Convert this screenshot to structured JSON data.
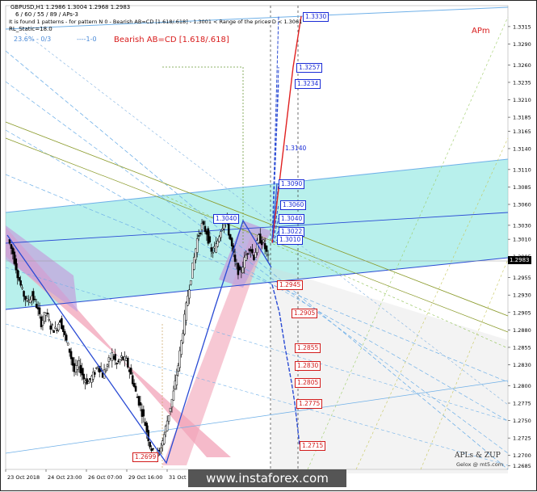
{
  "header": {
    "symbol_line": "GBPUSD,H1  1.2986 1.3004 1.2968 1.2983",
    "params_line": "6 / 60 / 55 / 89 / APs-3",
    "pattern_line": "It is found 1 patterns  -  for pattern N 0 - Bearish AB=CD [1.618/.618] - 1.3001 < Range of the prices D < 1.3061",
    "static_line": "RL_Static=18.0",
    "fib_label": "23.6% - 0/3",
    "level_label": "----1-0",
    "pattern_title": "Bearish AB=CD [1.618/.618]",
    "corner_label": "APm"
  },
  "watermark": {
    "brand": "APLs & ZUP",
    "copyright": "Gelox @ mt5.com",
    "site": "www.instaforex.com"
  },
  "current_price": "1.2983",
  "chart_data": {
    "type": "candlestick",
    "title": "GBPUSD,H1",
    "x_ticks": [
      "23 Oct 2018",
      "24 Oct 23:00",
      "26 Oct 07:00",
      "29 Oct 16:00",
      "31 Oct 00:00"
    ],
    "y_ticks": [
      "1.3315",
      "1.3290",
      "1.3260",
      "1.3235",
      "1.3210",
      "1.3185",
      "1.3165",
      "1.3140",
      "1.3110",
      "1.3085",
      "1.3060",
      "1.3030",
      "1.3010",
      "1.2985",
      "1.2955",
      "1.2930",
      "1.2905",
      "1.2880",
      "1.2855",
      "1.2830",
      "1.2800",
      "1.2775",
      "1.2750",
      "1.2725",
      "1.2700",
      "1.2685"
    ],
    "ylim": [
      1.268,
      1.3345
    ],
    "price_path": [
      1.301,
      1.299,
      1.296,
      1.2935,
      1.292,
      1.293,
      1.2915,
      1.289,
      1.2905,
      1.2885,
      1.288,
      1.2895,
      1.287,
      1.285,
      1.282,
      1.283,
      1.281,
      1.2805,
      1.2815,
      1.283,
      1.2815,
      1.283,
      1.2845,
      1.283,
      1.284,
      1.2835,
      1.2815,
      1.279,
      1.277,
      1.2745,
      1.2715,
      1.2699,
      1.2705,
      1.273,
      1.276,
      1.279,
      1.283,
      1.288,
      1.293,
      1.297,
      1.301,
      1.303,
      1.302,
      1.299,
      1.3,
      1.3025,
      1.304,
      1.301,
      1.2975,
      1.296,
      1.298,
      1.3,
      1.2985,
      1.3012,
      1.3004,
      1.2983
    ],
    "levels_blue": [
      {
        "label": "1.3330",
        "value": 1.333
      },
      {
        "label": "1.3257",
        "value": 1.3257
      },
      {
        "label": "1.3234",
        "value": 1.3234
      },
      {
        "label": "1.3090",
        "value": 1.309
      },
      {
        "label": "1.3060",
        "value": 1.306
      },
      {
        "label": "1.3040",
        "value": 1.304
      },
      {
        "label": "1.3022",
        "value": 1.3022
      },
      {
        "label": "1.3010",
        "value": 1.301
      }
    ],
    "levels_red": [
      {
        "label": "1.2945",
        "value": 1.2945
      },
      {
        "label": "1.2905",
        "value": 1.2905
      },
      {
        "label": "1.2855",
        "value": 1.2855
      },
      {
        "label": "1.2830",
        "value": 1.283
      },
      {
        "label": "1.2805",
        "value": 1.2805
      },
      {
        "label": "1.2775",
        "value": 1.2775
      },
      {
        "label": "1.2715",
        "value": 1.2715
      }
    ],
    "extra_labels": [
      {
        "label": "1.3140",
        "value": 1.314
      },
      {
        "label": "1.3040",
        "value": 1.304
      },
      {
        "label": "1.2699",
        "value": 1.2699
      }
    ],
    "colors": {
      "cyan_band": "#7ee3dc",
      "pink_band": "#f2a3b8",
      "violet_band": "#c3a0dd",
      "blue_line": "#2a4bd4",
      "red_line": "#e02020",
      "light_blue": "#6fb0e8",
      "olive": "#8a9a2a"
    }
  }
}
